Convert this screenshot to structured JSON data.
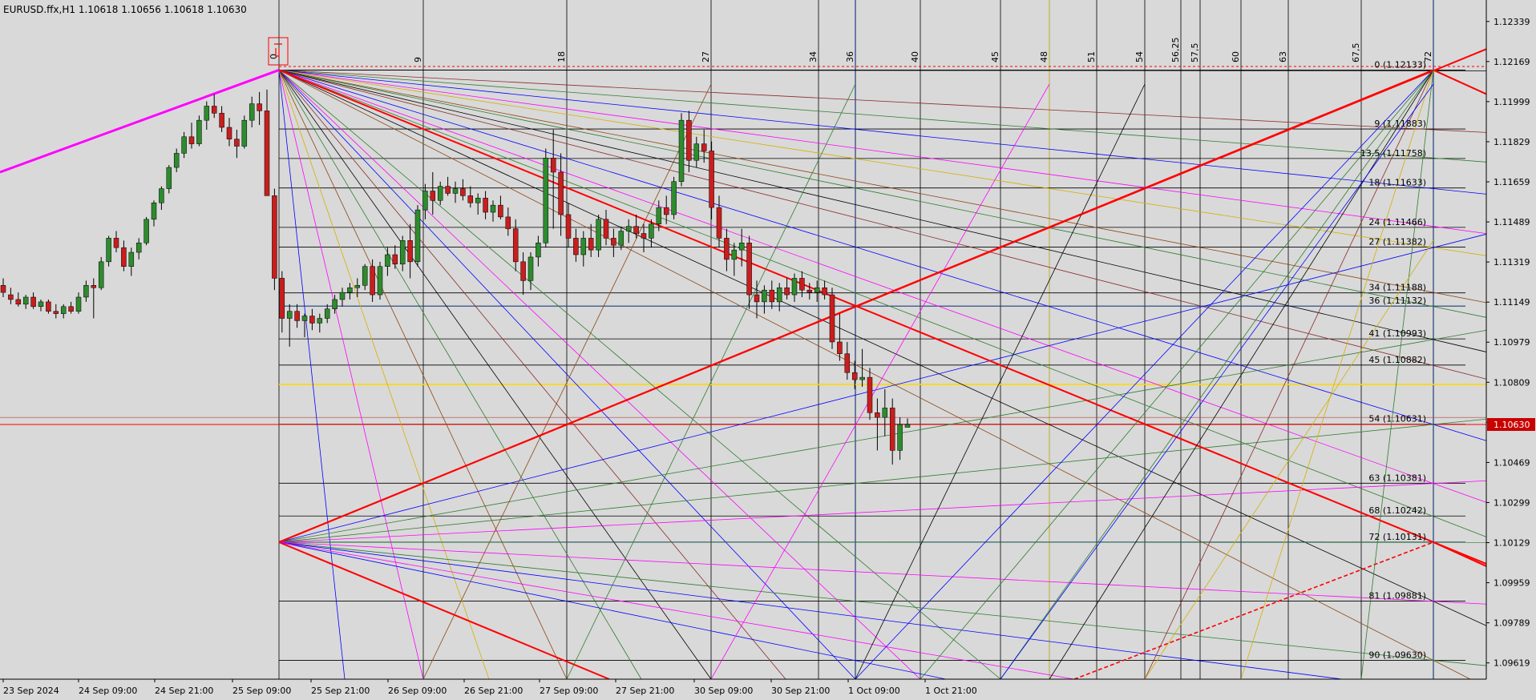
{
  "window": {
    "symbol_line": "EURUSD.ffx,H1  1.10618 1.10656 1.10618 1.10630"
  },
  "colors": {
    "background": "#d9d9d9",
    "bull": "#2e8b2e",
    "bear": "#c81e1e",
    "accent_magenta": "#ff00ff",
    "accent_red": "#ff0000",
    "gold": "#ffd700",
    "navy": "#1f3f7a"
  },
  "chart_data": {
    "type": "candlestick",
    "symbol": "EURUSD.ffx",
    "timeframe": "H1",
    "ohlc_header": [
      1.10618,
      1.10656,
      1.10618,
      1.1063
    ],
    "current_price": "1.10630",
    "y_ticks": [
      "1.12339",
      "1.12169",
      "1.11999",
      "1.11829",
      "1.11659",
      "1.11489",
      "1.11319",
      "1.11149",
      "1.10979",
      "1.10809",
      "1.10639",
      "1.10469",
      "1.10299",
      "1.10129",
      "1.09959",
      "1.09789",
      "1.09619"
    ],
    "x_ticks": [
      "23 Sep 2024",
      "24 Sep 09:00",
      "24 Sep 21:00",
      "25 Sep 09:00",
      "25 Sep 21:00",
      "26 Sep 09:00",
      "26 Sep 21:00",
      "27 Sep 09:00",
      "27 Sep 21:00",
      "30 Sep 09:00",
      "30 Sep 21:00",
      "1 Oct 09:00",
      "1 Oct 21:00"
    ],
    "gann_columns": [
      "0",
      "9",
      "18",
      "27",
      "34",
      "36",
      "40",
      "45",
      "48",
      "51",
      "54",
      "56,25",
      "57,5",
      "60",
      "63",
      "67,5",
      "72"
    ],
    "gann_levels": [
      {
        "label": "0 (1.12133)",
        "price": 1.12133
      },
      {
        "label": "9 (1.11883)",
        "price": 1.11883
      },
      {
        "label": "13.5 (1.11758)",
        "price": 1.11758
      },
      {
        "label": "18 (1.11633)",
        "price": 1.11633
      },
      {
        "label": "24 (1.11466)",
        "price": 1.11466
      },
      {
        "label": "27 (1.11382)",
        "price": 1.11382
      },
      {
        "label": "34 (1.11188)",
        "price": 1.11188
      },
      {
        "label": "36 (1.11132)",
        "price": 1.11132
      },
      {
        "label": "41 (1.10993)",
        "price": 1.10993
      },
      {
        "label": "45 (1.10882)",
        "price": 1.10882
      },
      {
        "label": "54 (1.10631)",
        "price": 1.10631
      },
      {
        "label": "63 (1.10381)",
        "price": 1.10381
      },
      {
        "label": "68 (1.10242)",
        "price": 1.10242
      },
      {
        "label": "72 (1.10131)",
        "price": 1.10131
      },
      {
        "label": "81 (1.09881)",
        "price": 1.09881
      },
      {
        "label": "90 (1.09630)",
        "price": 1.0963
      }
    ],
    "candles": [
      [
        1.1122,
        1.1125,
        1.1117,
        1.1119
      ],
      [
        1.1118,
        1.1121,
        1.1114,
        1.1116
      ],
      [
        1.1116,
        1.1119,
        1.1113,
        1.1114
      ],
      [
        1.1114,
        1.1118,
        1.1112,
        1.1117
      ],
      [
        1.1117,
        1.1119,
        1.1112,
        1.1113
      ],
      [
        1.1113,
        1.1116,
        1.1111,
        1.1115
      ],
      [
        1.1115,
        1.1116,
        1.111,
        1.1111
      ],
      [
        1.1111,
        1.1114,
        1.1108,
        1.111
      ],
      [
        1.111,
        1.1114,
        1.1108,
        1.1113
      ],
      [
        1.1113,
        1.1115,
        1.111,
        1.1111
      ],
      [
        1.1111,
        1.1119,
        1.111,
        1.1117
      ],
      [
        1.1117,
        1.1124,
        1.1115,
        1.1122
      ],
      [
        1.1122,
        1.1125,
        1.1108,
        1.1121
      ],
      [
        1.1121,
        1.1134,
        1.112,
        1.1132
      ],
      [
        1.1132,
        1.1143,
        1.113,
        1.1142
      ],
      [
        1.1142,
        1.1145,
        1.1136,
        1.1138
      ],
      [
        1.1138,
        1.1141,
        1.1128,
        1.113
      ],
      [
        1.113,
        1.1138,
        1.1126,
        1.1136
      ],
      [
        1.1136,
        1.1142,
        1.1133,
        1.114
      ],
      [
        1.114,
        1.1151,
        1.1139,
        1.115
      ],
      [
        1.115,
        1.1158,
        1.1147,
        1.1157
      ],
      [
        1.1157,
        1.1164,
        1.1154,
        1.1163
      ],
      [
        1.1163,
        1.1173,
        1.1161,
        1.1172
      ],
      [
        1.1172,
        1.118,
        1.117,
        1.1178
      ],
      [
        1.1178,
        1.1187,
        1.1176,
        1.1185
      ],
      [
        1.1185,
        1.1191,
        1.118,
        1.1182
      ],
      [
        1.1182,
        1.1194,
        1.1181,
        1.1192
      ],
      [
        1.1192,
        1.12,
        1.1188,
        1.1198
      ],
      [
        1.1198,
        1.1203,
        1.1193,
        1.1195
      ],
      [
        1.1195,
        1.1198,
        1.1187,
        1.1189
      ],
      [
        1.1189,
        1.1193,
        1.1181,
        1.1184
      ],
      [
        1.1184,
        1.1188,
        1.1176,
        1.1181
      ],
      [
        1.1181,
        1.1194,
        1.118,
        1.1192
      ],
      [
        1.1192,
        1.1202,
        1.1189,
        1.1199
      ],
      [
        1.1199,
        1.1204,
        1.119,
        1.1196
      ],
      [
        1.1196,
        1.1205,
        1.1192,
        1.116
      ],
      [
        1.116,
        1.1163,
        1.112,
        1.1125
      ],
      [
        1.1125,
        1.1128,
        1.1102,
        1.1108
      ],
      [
        1.1108,
        1.1114,
        1.1096,
        1.1111
      ],
      [
        1.1111,
        1.1114,
        1.1104,
        1.1107
      ],
      [
        1.1107,
        1.111,
        1.11,
        1.1109
      ],
      [
        1.1109,
        1.1112,
        1.1103,
        1.1106
      ],
      [
        1.1106,
        1.111,
        1.1102,
        1.1108
      ],
      [
        1.1108,
        1.1114,
        1.1106,
        1.1112
      ],
      [
        1.1112,
        1.1118,
        1.111,
        1.1116
      ],
      [
        1.1116,
        1.1121,
        1.1113,
        1.1119
      ],
      [
        1.1119,
        1.1123,
        1.1116,
        1.1121
      ],
      [
        1.1121,
        1.1125,
        1.1117,
        1.1122
      ],
      [
        1.1122,
        1.1131,
        1.112,
        1.113
      ],
      [
        1.113,
        1.1133,
        1.1115,
        1.1118
      ],
      [
        1.1118,
        1.1132,
        1.1116,
        1.113
      ],
      [
        1.113,
        1.1138,
        1.1126,
        1.1135
      ],
      [
        1.1135,
        1.1139,
        1.1129,
        1.1131
      ],
      [
        1.1131,
        1.1143,
        1.1128,
        1.1141
      ],
      [
        1.1141,
        1.1148,
        1.1125,
        1.1132
      ],
      [
        1.1132,
        1.1156,
        1.113,
        1.1154
      ],
      [
        1.1154,
        1.1165,
        1.115,
        1.1162
      ],
      [
        1.1162,
        1.117,
        1.1152,
        1.1158
      ],
      [
        1.1158,
        1.1166,
        1.1156,
        1.1164
      ],
      [
        1.1164,
        1.1168,
        1.116,
        1.1161
      ],
      [
        1.1161,
        1.1166,
        1.1157,
        1.1163
      ],
      [
        1.1163,
        1.1167,
        1.1158,
        1.116
      ],
      [
        1.116,
        1.1164,
        1.1155,
        1.1157
      ],
      [
        1.1157,
        1.1161,
        1.1152,
        1.1159
      ],
      [
        1.1159,
        1.1162,
        1.115,
        1.1153
      ],
      [
        1.1153,
        1.1158,
        1.1149,
        1.1156
      ],
      [
        1.1156,
        1.116,
        1.115,
        1.1151
      ],
      [
        1.1151,
        1.1155,
        1.1143,
        1.1146
      ],
      [
        1.1146,
        1.115,
        1.1128,
        1.1132
      ],
      [
        1.1132,
        1.1136,
        1.1118,
        1.1124
      ],
      [
        1.1124,
        1.1136,
        1.112,
        1.1134
      ],
      [
        1.1134,
        1.1143,
        1.113,
        1.114
      ],
      [
        1.114,
        1.118,
        1.1138,
        1.1176
      ],
      [
        1.1176,
        1.1188,
        1.1146,
        1.117
      ],
      [
        1.117,
        1.1178,
        1.1143,
        1.1152
      ],
      [
        1.1152,
        1.1157,
        1.1138,
        1.1142
      ],
      [
        1.1142,
        1.1146,
        1.1132,
        1.1135
      ],
      [
        1.1135,
        1.1145,
        1.113,
        1.1142
      ],
      [
        1.1142,
        1.1148,
        1.1134,
        1.1137
      ],
      [
        1.1137,
        1.1152,
        1.1134,
        1.115
      ],
      [
        1.115,
        1.1154,
        1.1139,
        1.1142
      ],
      [
        1.1142,
        1.1146,
        1.1134,
        1.1139
      ],
      [
        1.1139,
        1.1147,
        1.1137,
        1.1145
      ],
      [
        1.1145,
        1.115,
        1.114,
        1.1147
      ],
      [
        1.1147,
        1.1152,
        1.1142,
        1.1144
      ],
      [
        1.1144,
        1.1148,
        1.1136,
        1.1142
      ],
      [
        1.1142,
        1.115,
        1.1138,
        1.1148
      ],
      [
        1.1148,
        1.1158,
        1.1145,
        1.1155
      ],
      [
        1.1155,
        1.116,
        1.1148,
        1.1152
      ],
      [
        1.1152,
        1.1168,
        1.115,
        1.1166
      ],
      [
        1.1166,
        1.1195,
        1.1164,
        1.1192
      ],
      [
        1.1192,
        1.1196,
        1.117,
        1.1175
      ],
      [
        1.1175,
        1.1185,
        1.1172,
        1.1182
      ],
      [
        1.1182,
        1.1188,
        1.1174,
        1.1179
      ],
      [
        1.1179,
        1.1183,
        1.115,
        1.1155
      ],
      [
        1.1155,
        1.116,
        1.1138,
        1.1142
      ],
      [
        1.1142,
        1.1146,
        1.1128,
        1.1133
      ],
      [
        1.1133,
        1.114,
        1.1126,
        1.1137
      ],
      [
        1.1137,
        1.1146,
        1.113,
        1.114
      ],
      [
        1.114,
        1.1143,
        1.1112,
        1.1118
      ],
      [
        1.1118,
        1.1124,
        1.1108,
        1.1115
      ],
      [
        1.1115,
        1.1122,
        1.111,
        1.112
      ],
      [
        1.112,
        1.1124,
        1.1112,
        1.1115
      ],
      [
        1.1115,
        1.1123,
        1.1111,
        1.1121
      ],
      [
        1.1121,
        1.1125,
        1.1116,
        1.1118
      ],
      [
        1.1118,
        1.1127,
        1.1115,
        1.1125
      ],
      [
        1.1125,
        1.1128,
        1.1117,
        1.112
      ],
      [
        1.112,
        1.1123,
        1.1116,
        1.1119
      ],
      [
        1.1119,
        1.1124,
        1.1115,
        1.1121
      ],
      [
        1.1121,
        1.1124,
        1.1116,
        1.1118
      ],
      [
        1.1118,
        1.1121,
        1.1095,
        1.1098
      ],
      [
        1.1098,
        1.111,
        1.109,
        1.1093
      ],
      [
        1.1093,
        1.1098,
        1.1082,
        1.1085
      ],
      [
        1.1085,
        1.109,
        1.1078,
        1.1082
      ],
      [
        1.1082,
        1.1095,
        1.1079,
        1.1083
      ],
      [
        1.1083,
        1.1087,
        1.1065,
        1.1068
      ],
      [
        1.1068,
        1.1074,
        1.1052,
        1.1066
      ],
      [
        1.1066,
        1.1078,
        1.1058,
        1.107
      ],
      [
        1.107,
        1.1074,
        1.1046,
        1.1052
      ],
      [
        1.1052,
        1.1066,
        1.1048,
        1.1063
      ],
      [
        1.10618,
        1.10656,
        1.10618,
        1.1063
      ]
    ]
  }
}
